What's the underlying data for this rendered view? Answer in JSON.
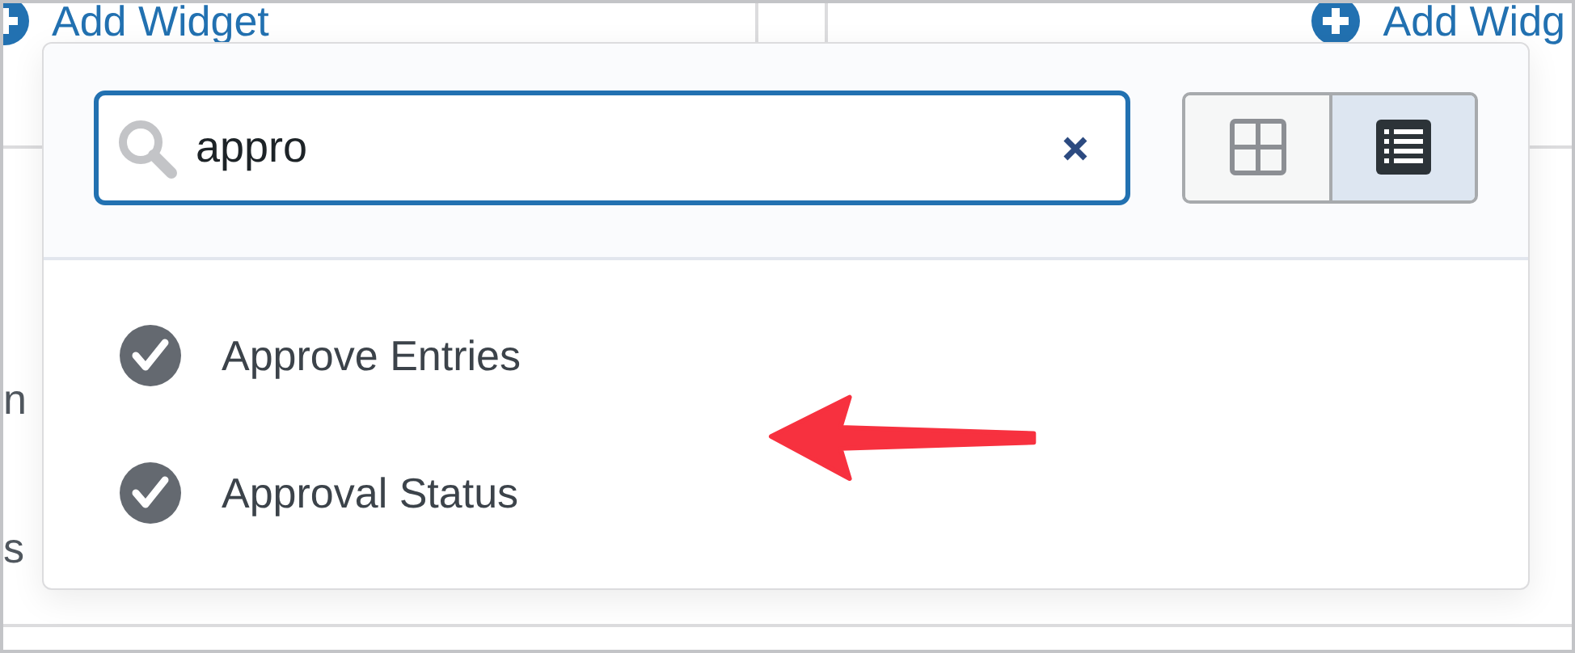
{
  "add_widget_links": [
    {
      "label": "Add Widget"
    },
    {
      "label": "Add Widg"
    }
  ],
  "cut_texts": [
    "n",
    "s"
  ],
  "search": {
    "value": "appro"
  },
  "view_toggle": [
    {
      "kind": "grid",
      "selected": false
    },
    {
      "kind": "list",
      "selected": true
    }
  ],
  "results": [
    {
      "label": "Approve Entries"
    },
    {
      "label": "Approval Status"
    }
  ]
}
